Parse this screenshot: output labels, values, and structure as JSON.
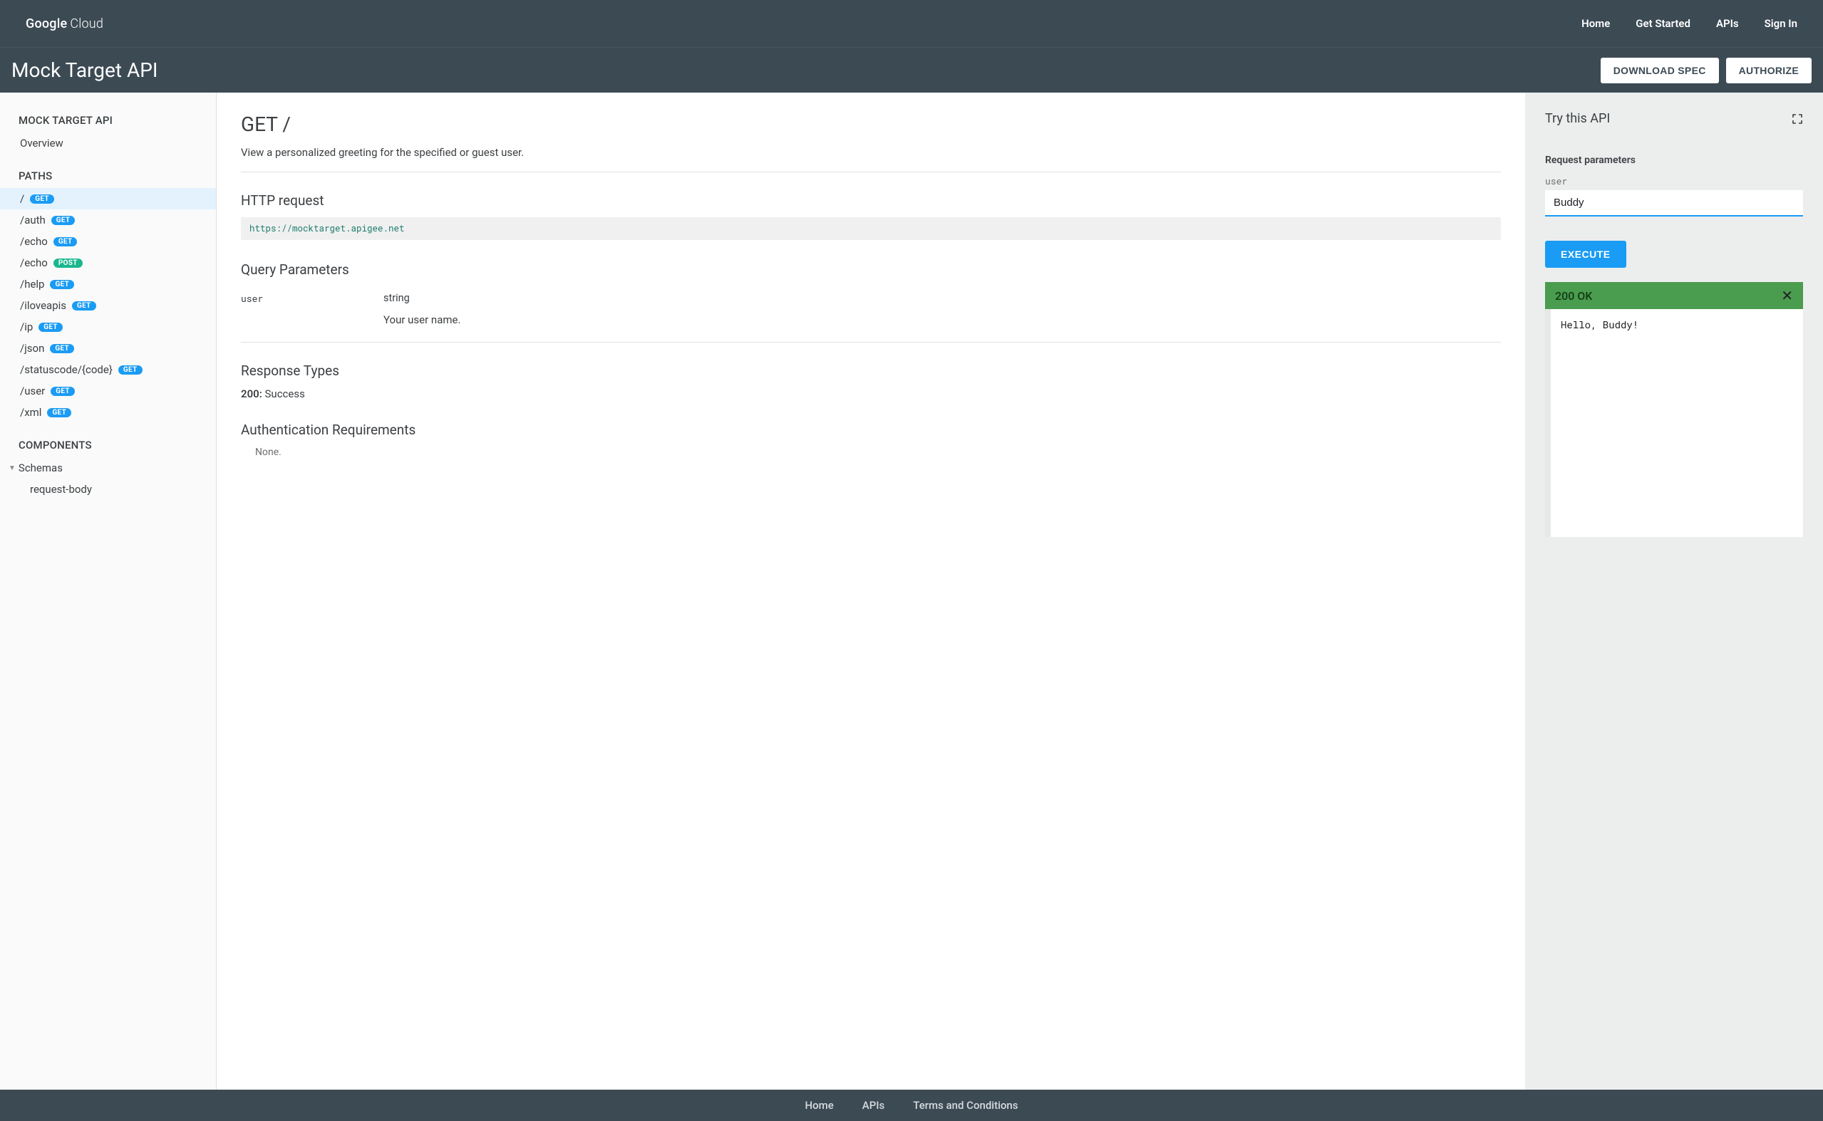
{
  "brand": {
    "part1": "Google",
    "part2": "Cloud"
  },
  "topnav": {
    "home": "Home",
    "get_started": "Get Started",
    "apis": "APIs",
    "sign_in": "Sign In"
  },
  "subheader": {
    "title": "Mock Target API",
    "download_spec": "DOWNLOAD SPEC",
    "authorize": "AUTHORIZE"
  },
  "sidebar": {
    "api_title": "MOCK TARGET API",
    "overview": "Overview",
    "paths_title": "PATHS",
    "paths": [
      {
        "path": "/",
        "method": "GET",
        "active": true
      },
      {
        "path": "/auth",
        "method": "GET",
        "active": false
      },
      {
        "path": "/echo",
        "method": "GET",
        "active": false
      },
      {
        "path": "/echo",
        "method": "POST",
        "active": false
      },
      {
        "path": "/help",
        "method": "GET",
        "active": false
      },
      {
        "path": "/iloveapis",
        "method": "GET",
        "active": false
      },
      {
        "path": "/ip",
        "method": "GET",
        "active": false
      },
      {
        "path": "/json",
        "method": "GET",
        "active": false
      },
      {
        "path": "/statuscode/{code}",
        "method": "GET",
        "active": false
      },
      {
        "path": "/user",
        "method": "GET",
        "active": false
      },
      {
        "path": "/xml",
        "method": "GET",
        "active": false
      }
    ],
    "components_title": "COMPONENTS",
    "schemas_label": "Schemas",
    "schema_item": "request-body"
  },
  "content": {
    "title": "GET /",
    "description": "View a personalized greeting for the specified or guest user.",
    "http_request_heading": "HTTP request",
    "http_request_url": "https://mocktarget.apigee.net",
    "query_params_heading": "Query Parameters",
    "param_name": "user",
    "param_type": "string",
    "param_desc": "Your user name.",
    "response_types_heading": "Response Types",
    "response_code": "200:",
    "response_text": " Success",
    "auth_heading": "Authentication Requirements",
    "auth_none": "None."
  },
  "tryapi": {
    "heading": "Try this API",
    "request_params_label": "Request parameters",
    "param_label": "user",
    "param_value": "Buddy",
    "execute": "EXECUTE",
    "status": "200 OK",
    "response_body": "Hello, Buddy!"
  },
  "footer": {
    "home": "Home",
    "apis": "APIs",
    "terms": "Terms and Conditions"
  }
}
